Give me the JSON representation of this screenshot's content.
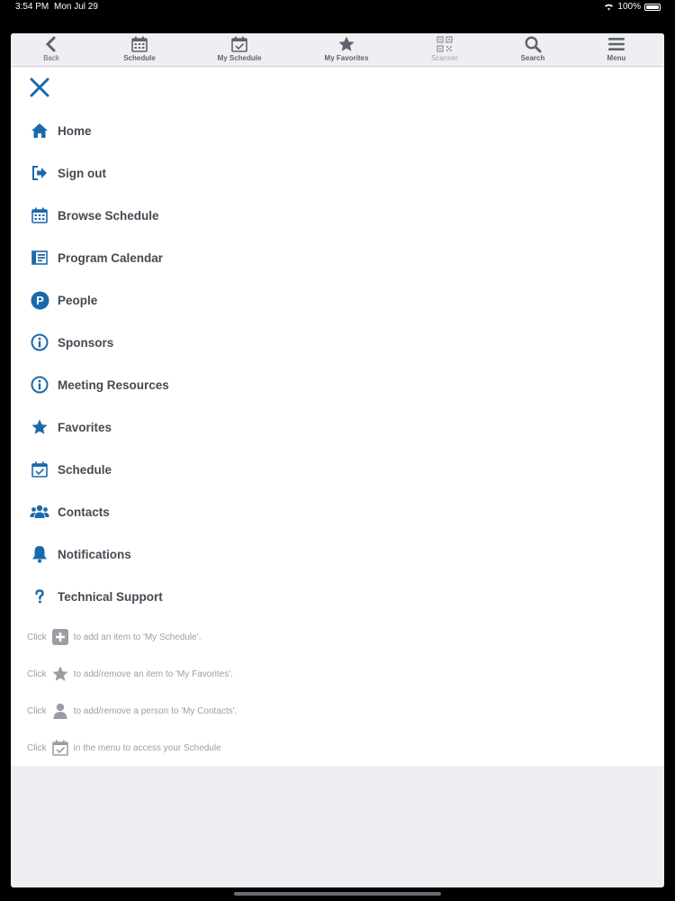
{
  "status": {
    "time": "3:54 PM",
    "date": "Mon Jul 29",
    "battery": "100%"
  },
  "colors": {
    "accent": "#1a6aab",
    "text": "#454a52",
    "toolbar_icon": "#5d6470",
    "hint_icon": "#9a9ea4"
  },
  "toolbar": {
    "items": [
      {
        "label": "Back",
        "icon": "chevron-left-icon"
      },
      {
        "label": "Schedule",
        "icon": "calendar-icon"
      },
      {
        "label": "My Schedule",
        "icon": "calendar-check-icon"
      },
      {
        "label": "My Favorites",
        "icon": "star-icon"
      },
      {
        "label": "Scanner",
        "icon": "qr-code-icon"
      },
      {
        "label": "Search",
        "icon": "search-icon"
      },
      {
        "label": "Menu",
        "icon": "hamburger-icon"
      }
    ]
  },
  "menu": {
    "items": [
      {
        "label": "Home",
        "icon": "home-icon"
      },
      {
        "label": "Sign out",
        "icon": "sign-out-icon"
      },
      {
        "label": "Browse Schedule",
        "icon": "calendar-icon"
      },
      {
        "label": "Program Calendar",
        "icon": "program-calendar-icon"
      },
      {
        "label": "People",
        "icon": "people-p-icon"
      },
      {
        "label": "Sponsors",
        "icon": "info-icon"
      },
      {
        "label": "Meeting Resources",
        "icon": "info-icon"
      },
      {
        "label": "Favorites",
        "icon": "star-icon"
      },
      {
        "label": "Schedule",
        "icon": "calendar-check-icon"
      },
      {
        "label": "Contacts",
        "icon": "users-icon"
      },
      {
        "label": "Notifications",
        "icon": "bell-icon"
      },
      {
        "label": "Technical Support",
        "icon": "question-icon"
      }
    ]
  },
  "hints": [
    {
      "before": "Click",
      "icon": "plus-box-icon",
      "after": "to add an item to 'My Schedule'."
    },
    {
      "before": "Click",
      "icon": "star-icon",
      "after": "to add/remove an item to 'My Favorites'."
    },
    {
      "before": "Click",
      "icon": "person-icon",
      "after": "to add/remove a person to 'My Contacts'."
    },
    {
      "before": "Click",
      "icon": "calendar-check-icon",
      "after": "in the menu to access your Schedule"
    }
  ]
}
